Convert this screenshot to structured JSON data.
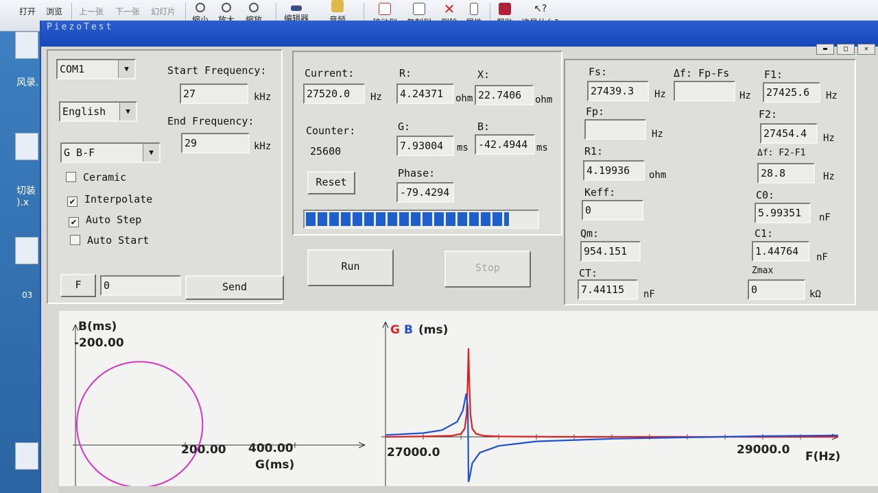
{
  "viewer_toolbar": {
    "items": [
      {
        "label": "打开"
      },
      {
        "label": "浏览"
      },
      {
        "label": "上一张"
      },
      {
        "label": "下一张"
      },
      {
        "label": "幻灯片"
      },
      {
        "label": "缩小"
      },
      {
        "label": "放大"
      },
      {
        "label": "缩放"
      },
      {
        "label": "编辑器"
      },
      {
        "label": "音频"
      },
      {
        "label": "移动到"
      },
      {
        "label": "复制到"
      },
      {
        "label": "删除"
      },
      {
        "label": "属性"
      },
      {
        "label": "帮助"
      },
      {
        "label": "这是什么?"
      }
    ]
  },
  "desktop": {
    "texts": [
      "风录.",
      "切装",
      ").x",
      "03"
    ]
  },
  "app": {
    "title": "PiezoTest"
  },
  "settings": {
    "port": "COM1",
    "language": "English",
    "mode": "G B-F",
    "start_frequency_label": "Start Frequency:",
    "start_frequency": "27",
    "start_unit": "kHz",
    "end_frequency_label": "End Frequency:",
    "end_frequency": "29",
    "end_unit": "kHz",
    "ceramic_label": "Ceramic",
    "ceramic_checked": false,
    "interpolate_label": "Interpolate",
    "interpolate_checked": true,
    "auto_step_label": "Auto Step",
    "auto_step_checked": true,
    "auto_start_label": "Auto Start",
    "auto_start_checked": false,
    "f_button": "F",
    "send_value": "0",
    "send_button": "Send"
  },
  "measurement": {
    "current_label": "Current:",
    "current_value": "27520.0",
    "current_unit": "Hz",
    "r_label": "R:",
    "r_value": "4.24371",
    "r_unit": "ohm",
    "x_label": "X:",
    "x_value": "22.7406",
    "x_unit": "ohm",
    "counter_label": "Counter:",
    "counter_value": "25600",
    "g_label": "G:",
    "g_value": "7.93004",
    "g_unit": "ms",
    "b_label": "B:",
    "b_value": "-42.4944",
    "b_unit": "ms",
    "reset_button": "Reset",
    "phase_label": "Phase:",
    "phase_value": "-79.4294",
    "progress_fraction": 0.88,
    "run_button": "Run",
    "stop_button": "Stop"
  },
  "results": {
    "fs_label": "Fs:",
    "fs_value": "27439.3",
    "fs_unit": "Hz",
    "df_fpfs_label": "Δf: Fp-Fs",
    "df_fpfs_value": "",
    "df_fpfs_unit": "Hz",
    "f1_label": "F1:",
    "f1_value": "27425.6",
    "f1_unit": "Hz",
    "fp_label": "Fp:",
    "fp_value": "",
    "fp_unit": "Hz",
    "f2_label": "F2:",
    "f2_value": "27454.4",
    "f2_unit": "Hz",
    "r1_label": "R1:",
    "r1_value": "4.19936",
    "r1_unit": "ohm",
    "df_f2f1_label": "Δf: F2-F1",
    "df_f2f1_value": "28.8",
    "df_f2f1_unit": "Hz",
    "keff_label": "Keff:",
    "keff_value": "0",
    "c0_label": "C0:",
    "c0_value": "5.99351",
    "c0_unit": "nF",
    "qm_label": "Qm:",
    "qm_value": "954.151",
    "c1_label": "C1:",
    "c1_value": "1.44764",
    "c1_unit": "nF",
    "ct_label": "CT:",
    "ct_value": "7.44115",
    "ct_unit": "nF",
    "zmax_label": "Zmax",
    "zmax_value": "0",
    "zmax_unit": "kΩ"
  },
  "colors": {
    "g_series": "#e02020",
    "b_series": "#1f4fd8",
    "admittance_circle": "#d832c8"
  },
  "chart_data": [
    {
      "type": "scatter",
      "ylabel": "B(ms)",
      "xlabel": "G(ms)",
      "y_tick_labels": [
        "200.00"
      ],
      "x_tick_labels": [
        "200.00",
        "400.00"
      ],
      "xlim": [
        0,
        500
      ],
      "ylim": [
        -100,
        230
      ],
      "series": [
        {
          "shape": "circle",
          "center": [
            117,
            0
          ],
          "radius": 117
        }
      ]
    },
    {
      "type": "line",
      "ylabel_parts": [
        "G",
        "B",
        "(ms)"
      ],
      "xlabel": "F(Hz)",
      "x_tick_labels": [
        "27000.0",
        "29000.0"
      ],
      "xlim": [
        27000,
        29400
      ],
      "ylim": [
        -150,
        250
      ],
      "series": [
        {
          "name": "G",
          "x": [
            27000,
            27200,
            27350,
            27400,
            27420,
            27430,
            27436,
            27440,
            27444,
            27450,
            27460,
            27480,
            27520,
            27600,
            28000,
            29000,
            29400
          ],
          "y": [
            0,
            1,
            3,
            8,
            22,
            60,
            150,
            235,
            150,
            60,
            22,
            8,
            3,
            1,
            0,
            0,
            0
          ]
        },
        {
          "name": "B",
          "x": [
            27000,
            27200,
            27300,
            27380,
            27410,
            27428,
            27436,
            27438,
            27440,
            27445,
            27460,
            27500,
            27600,
            27800,
            28200,
            29000,
            29400
          ],
          "y": [
            5,
            10,
            18,
            40,
            70,
            115,
            80,
            0,
            -120,
            -110,
            -70,
            -42,
            -24,
            -12,
            -5,
            2,
            4
          ]
        }
      ]
    }
  ]
}
